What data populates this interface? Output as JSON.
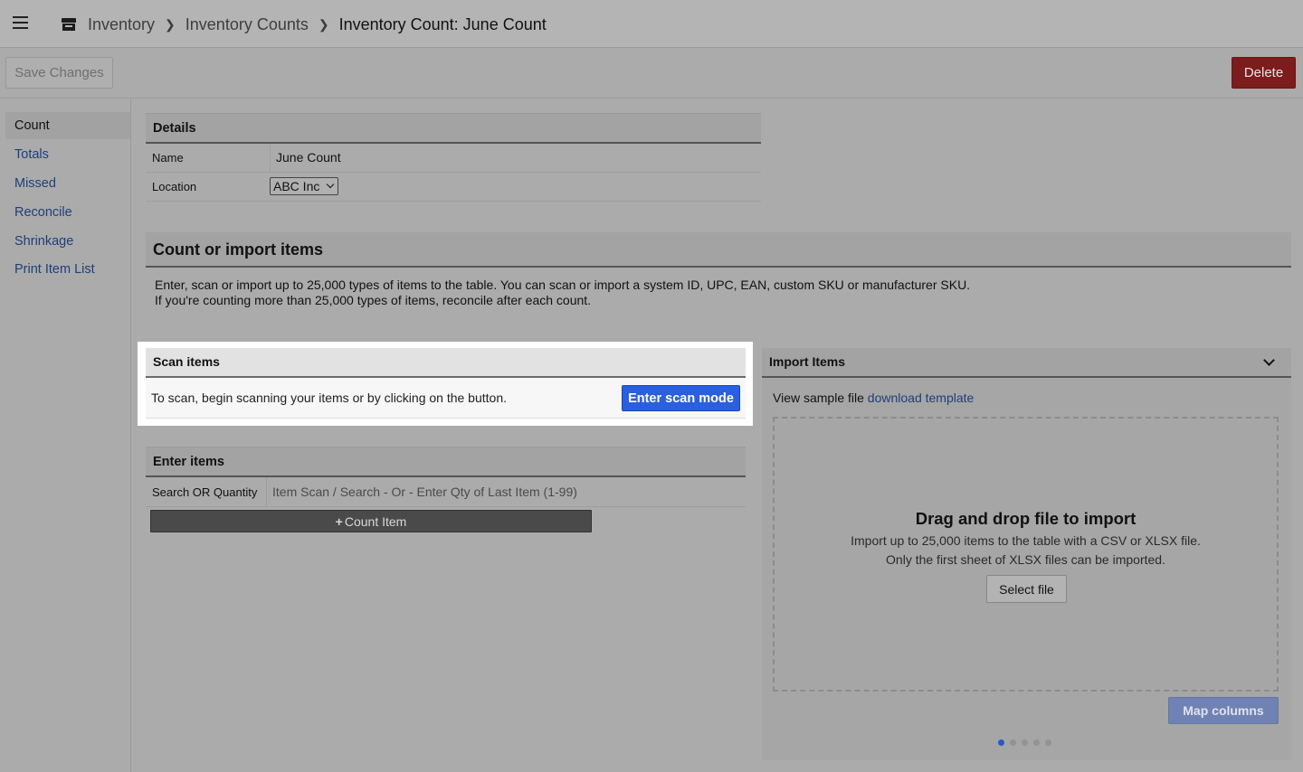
{
  "breadcrumb": {
    "items": [
      "Inventory",
      "Inventory Counts"
    ],
    "current": "Inventory Count: June Count"
  },
  "toolbar": {
    "save_label": "Save Changes",
    "delete_label": "Delete"
  },
  "sidebar": {
    "items": [
      {
        "label": "Count",
        "active": true
      },
      {
        "label": "Totals"
      },
      {
        "label": "Missed"
      },
      {
        "label": "Reconcile"
      },
      {
        "label": "Shrinkage"
      },
      {
        "label": "Print Item List"
      }
    ]
  },
  "details": {
    "title": "Details",
    "name_label": "Name",
    "name_value": "June Count",
    "location_label": "Location",
    "location_value": "ABC Inc"
  },
  "count_import": {
    "title": "Count or import items",
    "desc_line1": "Enter, scan or import up to 25,000 types of items to the table. You can scan or import a system ID, UPC, EAN, custom SKU or manufacturer SKU.",
    "desc_line2": "If you're counting more than 25,000 types of items, reconcile after each count."
  },
  "scan": {
    "title": "Scan items",
    "text": "To scan, begin scanning your items or by clicking on the button.",
    "button": "Enter scan mode"
  },
  "enter": {
    "title": "Enter items",
    "search_label": "Search OR Quantity",
    "search_placeholder": "Item Scan / Search - Or - Enter Qty of Last Item (1-99)",
    "count_button": "Count Item"
  },
  "import": {
    "title": "Import Items",
    "sample_prefix": "View sample file ",
    "sample_link": "download template",
    "dz_title": "Drag and drop file to import",
    "dz_line1": "Import up to 25,000 items to the table with a CSV or XLSX file.",
    "dz_line2": "Only the first sheet of XLSX files can be imported.",
    "select_button": "Select file",
    "map_button": "Map columns",
    "steps_total": 5,
    "steps_active": 1
  }
}
